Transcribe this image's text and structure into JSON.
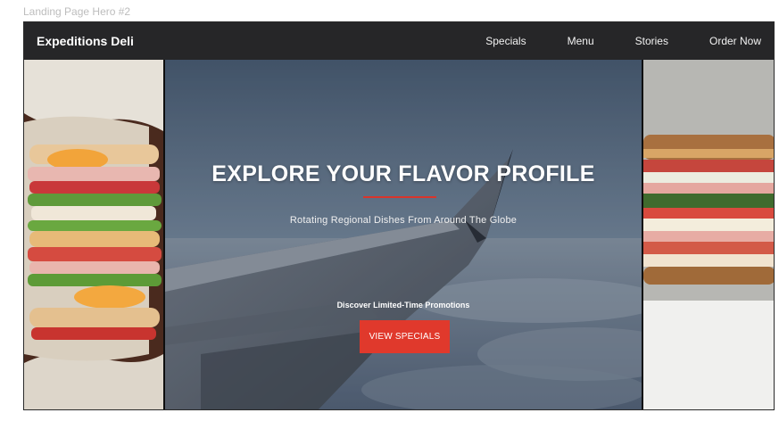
{
  "canvas_label": "Landing Page Hero #2",
  "navbar": {
    "brand": "Expeditions Deli",
    "links": [
      "Specials",
      "Menu",
      "Stories",
      "Order Now"
    ]
  },
  "hero": {
    "headline": "EXPLORE YOUR FLAVOR PROFILE",
    "subhead": "Rotating Regional Dishes From Around The Globe",
    "promo_label": "Discover Limited-Time Promotions",
    "cta_label": "VIEW SPECIALS"
  },
  "colors": {
    "accent": "#e0392c",
    "navbar_bg": "#262628",
    "divider": "#d9352b"
  }
}
